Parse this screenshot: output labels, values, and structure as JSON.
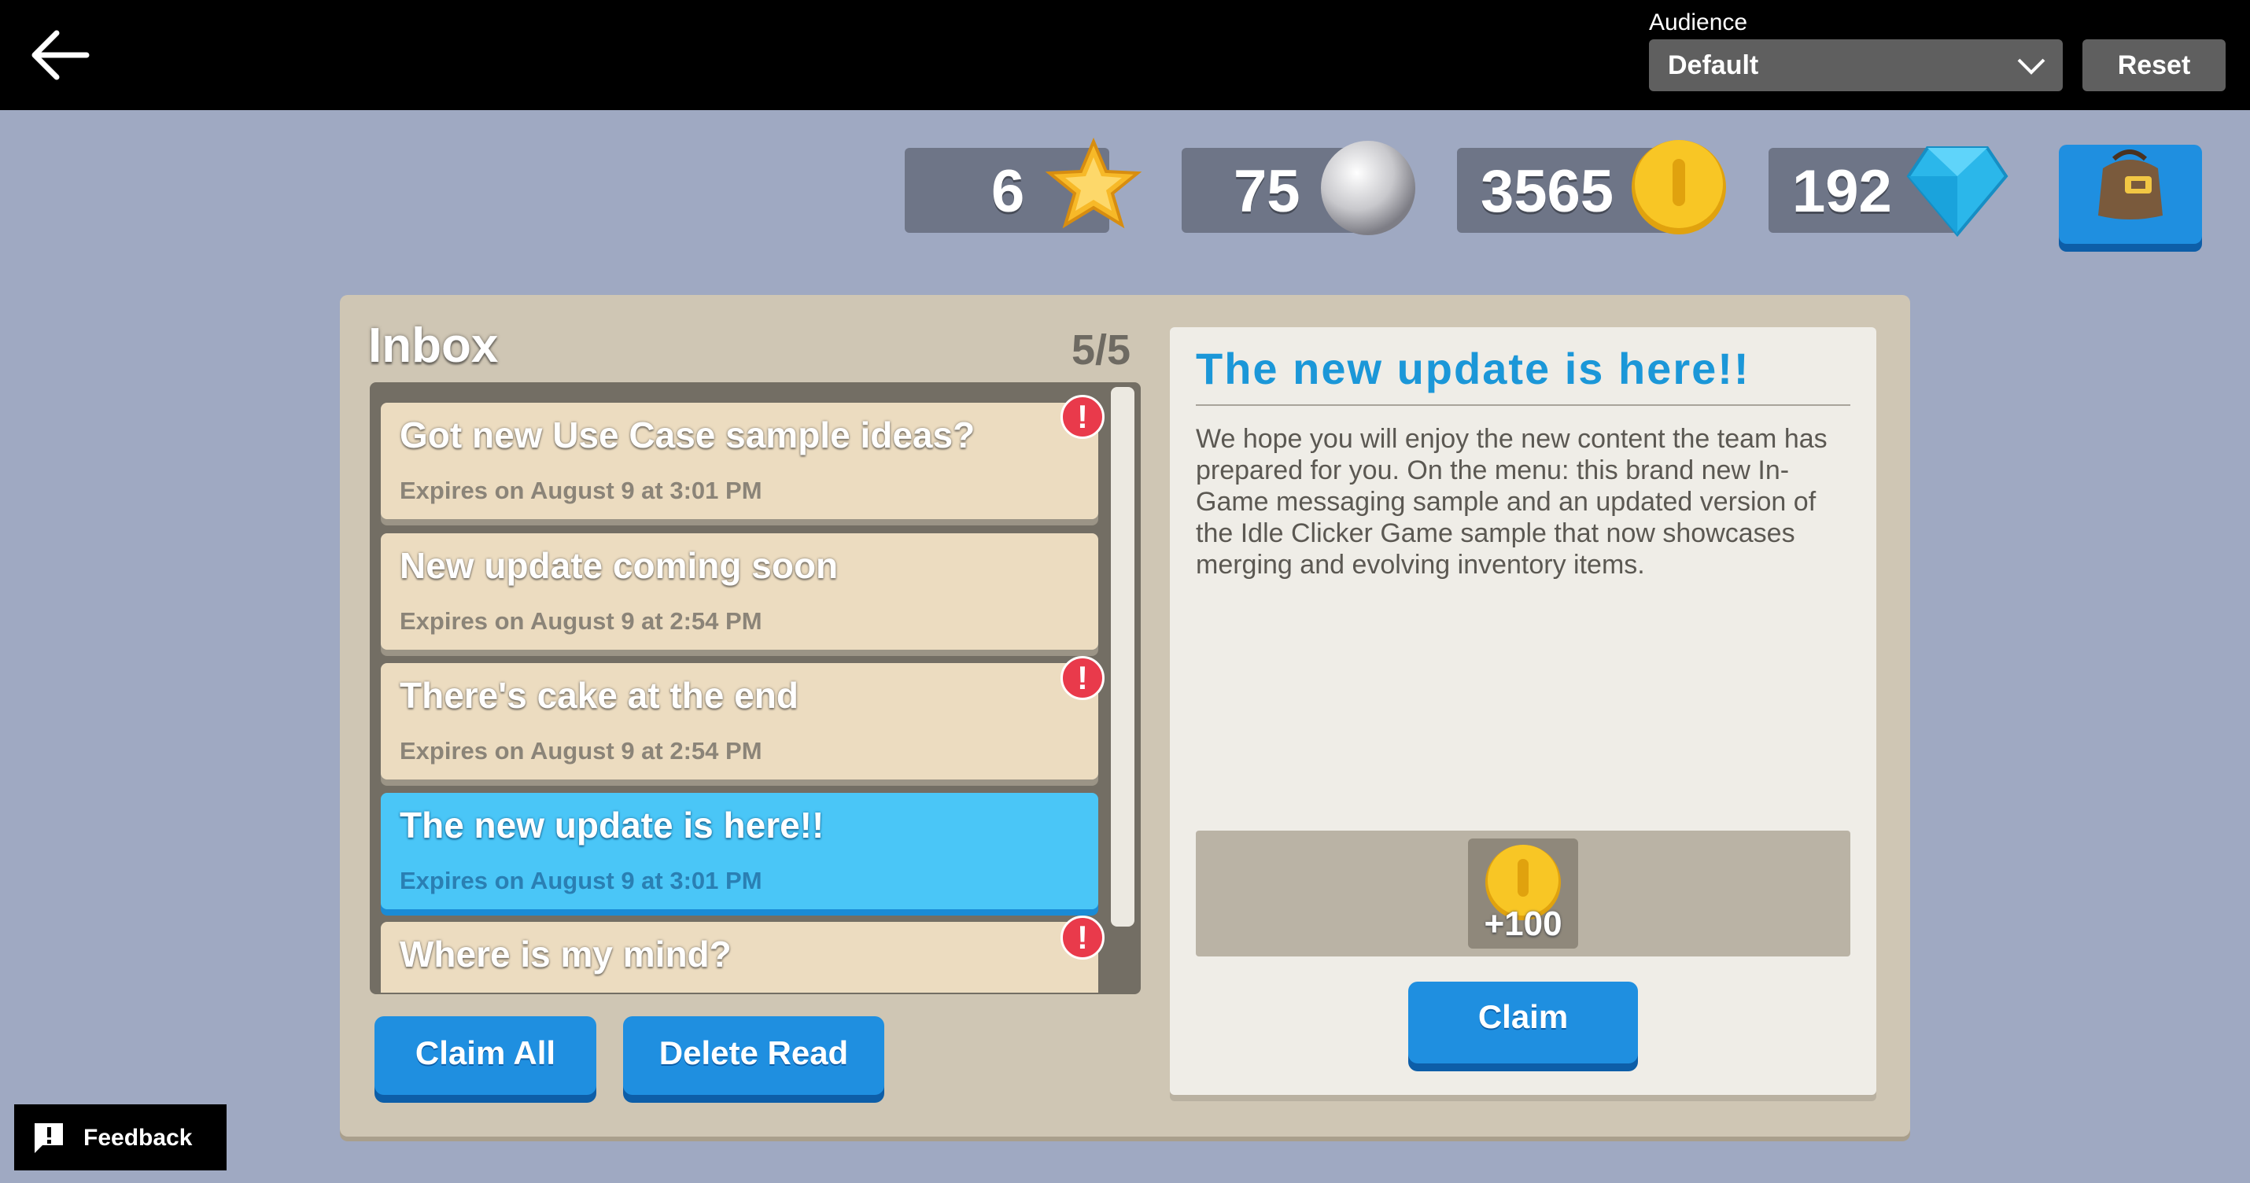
{
  "topbar": {
    "audience_label": "Audience",
    "audience_value": "Default",
    "reset_label": "Reset"
  },
  "currencies": {
    "stars": "6",
    "pearls": "75",
    "coins": "3565",
    "gems": "192"
  },
  "inbox": {
    "title": "Inbox",
    "count": "5/5",
    "messages": [
      {
        "subject": "Got new Use Case sample ideas?",
        "expires": "Expires on August 9 at 3:01 PM",
        "unread": true
      },
      {
        "subject": "New update coming soon",
        "expires": "Expires on August 9 at 2:54 PM",
        "unread": false
      },
      {
        "subject": "There's cake at the end",
        "expires": "Expires on August 9 at 2:54 PM",
        "unread": true
      },
      {
        "subject": "The new update is here!!",
        "expires": "Expires on August 9 at 3:01 PM",
        "unread": false,
        "selected": true
      },
      {
        "subject": "Where is my mind?",
        "expires": "",
        "unread": true
      }
    ],
    "claim_all_label": "Claim All",
    "delete_read_label": "Delete Read"
  },
  "detail": {
    "title": "The new update is here!!",
    "body": "We hope you will enjoy the new content the team has prepared for you. On the menu: this brand new In-Game messaging sample and an updated version of the Idle Clicker Game sample that now showcases merging and evolving inventory items.",
    "reward_amount": "+100",
    "claim_label": "Claim"
  },
  "feedback": {
    "label": "Feedback"
  },
  "colors": {
    "background": "#9fa9c2",
    "accent_blue": "#1f8fe0",
    "selected_item": "#4ac6f7",
    "title_blue": "#1b97d8",
    "badge_red": "#e93a4b"
  }
}
